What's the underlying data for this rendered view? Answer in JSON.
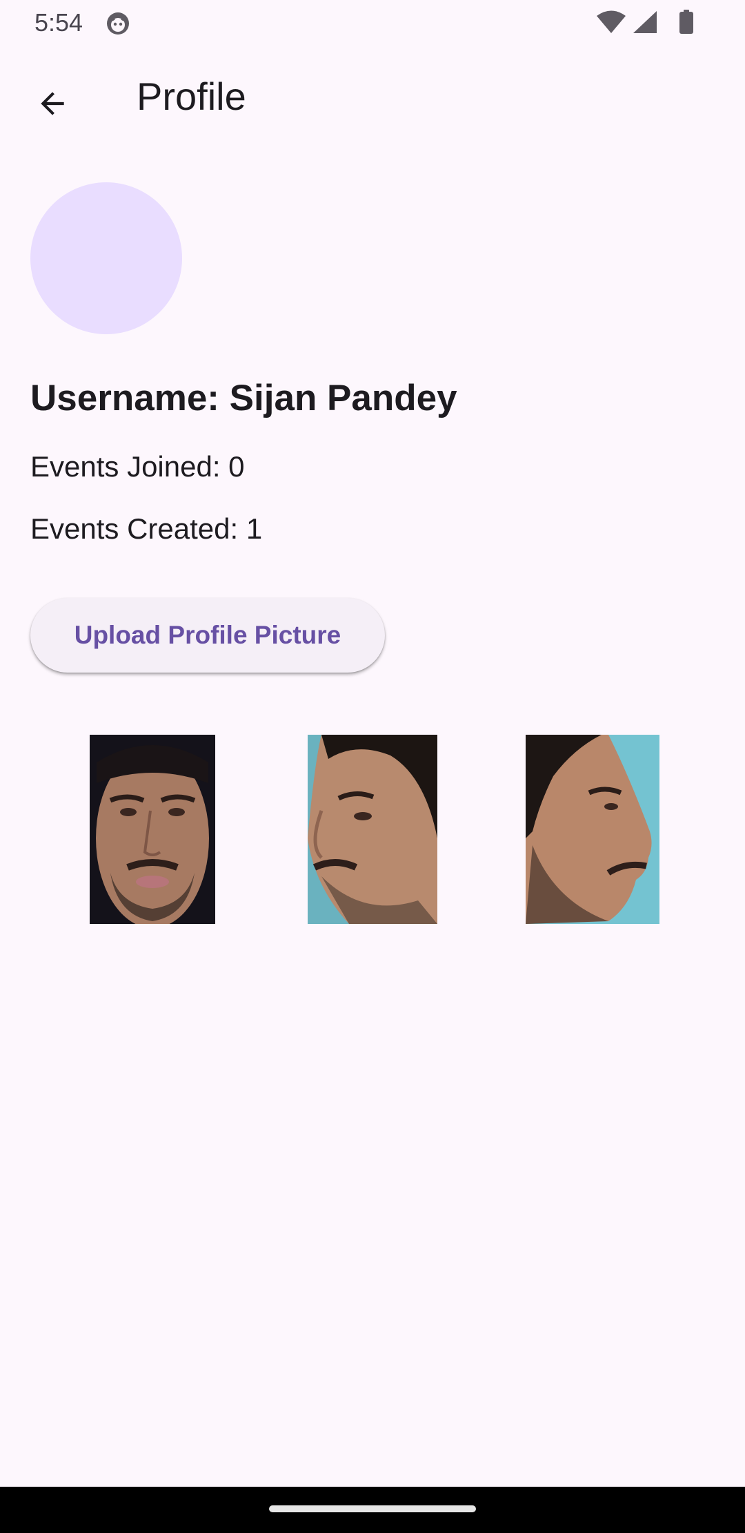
{
  "status_bar": {
    "time": "5:54",
    "app_icon": "android-debug-icon",
    "icons": [
      "wifi-icon",
      "cellular-signal-icon",
      "battery-icon"
    ]
  },
  "app_bar": {
    "back_icon": "arrow-back-icon",
    "title": "Profile"
  },
  "profile": {
    "avatar_color": "#e9ddff",
    "username": "Username: Sijan Pandey",
    "events_joined": "Events Joined: 0",
    "events_created": "Events Created: 1"
  },
  "actions": {
    "upload_label": "Upload Profile Picture"
  },
  "photos": [
    {
      "pose": "front"
    },
    {
      "pose": "three-quarter left"
    },
    {
      "pose": "right profile"
    }
  ],
  "colors": {
    "background": "#fdf7fd",
    "primary": "#6750a4",
    "button_surface": "#f5eff7",
    "text": "#1d1b20"
  }
}
